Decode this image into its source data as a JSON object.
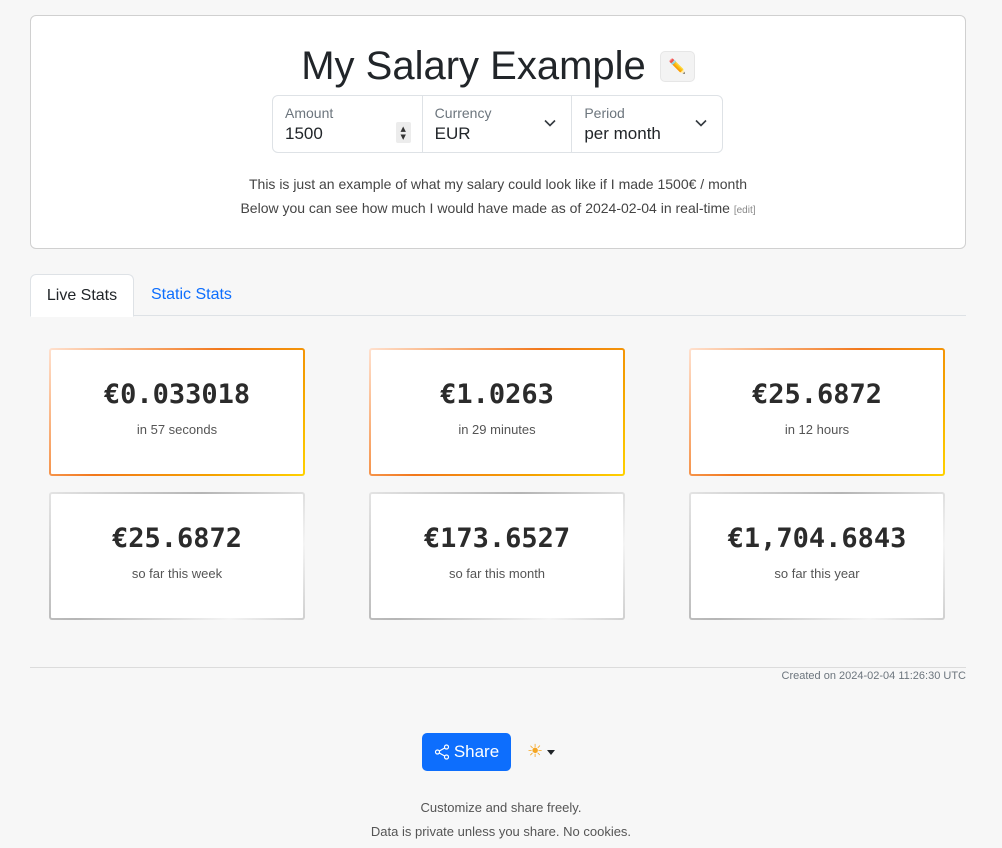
{
  "header": {
    "title": "My Salary Example",
    "edit_title_icon": "pencil-icon",
    "fields": {
      "amount": {
        "label": "Amount",
        "value": "1500"
      },
      "currency": {
        "label": "Currency",
        "value": "EUR"
      },
      "period": {
        "label": "Period",
        "value": "per month"
      }
    },
    "description_line1": "This is just an example of what my salary could look like if I made 1500€ / month",
    "description_line2": "Below you can see how much I would have made as of 2024-02-04 in real-time",
    "edit_link": "[edit]"
  },
  "tabs": [
    {
      "label": "Live Stats",
      "active": true
    },
    {
      "label": "Static Stats",
      "active": false
    }
  ],
  "live_stats": [
    {
      "value": "€0.033018",
      "label": "in 57 seconds"
    },
    {
      "value": "€1.0263",
      "label": "in 29 minutes"
    },
    {
      "value": "€25.6872",
      "label": "in 12 hours"
    }
  ],
  "static_stats": [
    {
      "value": "€25.6872",
      "label": "so far this week"
    },
    {
      "value": "€173.6527",
      "label": "so far this month"
    },
    {
      "value": "€1,704.6843",
      "label": "so far this year"
    }
  ],
  "created": "Created on 2024-02-04 11:26:30 UTC",
  "share_label": "Share",
  "share_icon": "share-icon",
  "theme_icon": "sun-icon",
  "theme_glyph": "☀",
  "tagline1": "Customize and share freely.",
  "tagline2": "Data is private unless you share. No cookies.",
  "colors": {
    "accent": "#0d6efd",
    "live_border_start": "#f2781c",
    "live_border_end": "#ffd100",
    "background": "#f7f7f7"
  }
}
